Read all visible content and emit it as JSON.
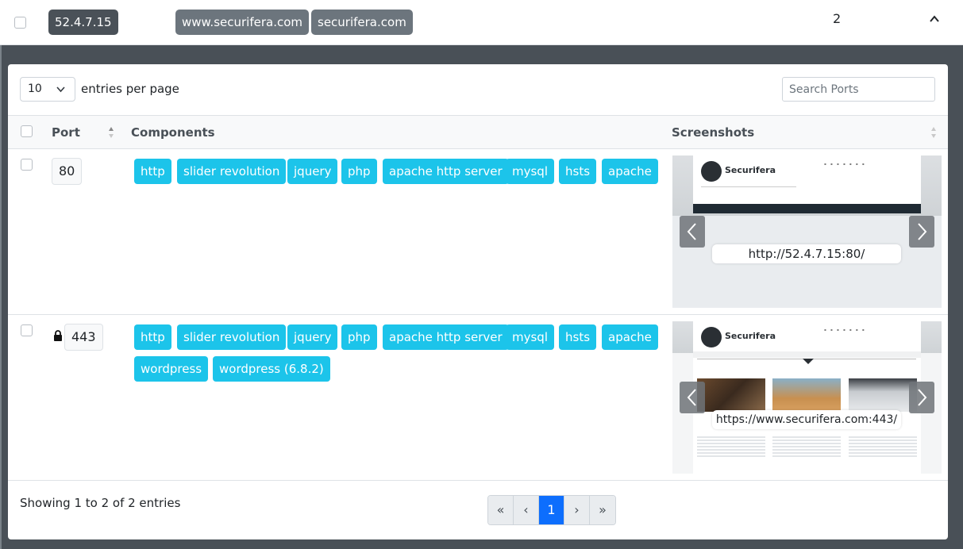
{
  "host": {
    "ip": "52.4.7.15",
    "domains": [
      "www.securifera.com",
      "securifera.com"
    ],
    "count": "2"
  },
  "table_controls": {
    "entries_value": "10",
    "entries_label": "entries per page",
    "search_placeholder": "Search Ports"
  },
  "columns": {
    "port": "Port",
    "components": "Components",
    "screenshots": "Screenshots"
  },
  "rows": [
    {
      "port": "80",
      "secure": false,
      "components": [
        "http",
        "slider revolution",
        "jquery",
        "php",
        "apache http server",
        "mysql",
        "hsts",
        "apache"
      ],
      "screenshot_url": "http://52.4.7.15:80/",
      "brand": "Securifera"
    },
    {
      "port": "443",
      "secure": true,
      "components": [
        "http",
        "slider revolution",
        "jquery",
        "php",
        "apache http server",
        "mysql",
        "hsts",
        "apache",
        "wordpress",
        "wordpress (6.8.2)"
      ],
      "screenshot_url": "https://www.securifera.com:443/",
      "brand": "Securifera"
    }
  ],
  "footer": {
    "showing": "Showing 1 to 2 of 2 entries"
  },
  "pagination": {
    "first": "«",
    "prev": "‹",
    "current": "1",
    "next": "›",
    "last": "»"
  },
  "icons": {
    "lock": "lock-icon",
    "prev_slide": "chevron-left-icon",
    "next_slide": "chevron-right-icon",
    "collapse": "chevron-up-icon"
  },
  "colors": {
    "component_badge": "#1cc4ea",
    "ip_badge": "#4a5158",
    "domain_badge": "#6c757d",
    "active_page": "#0d6efd"
  }
}
